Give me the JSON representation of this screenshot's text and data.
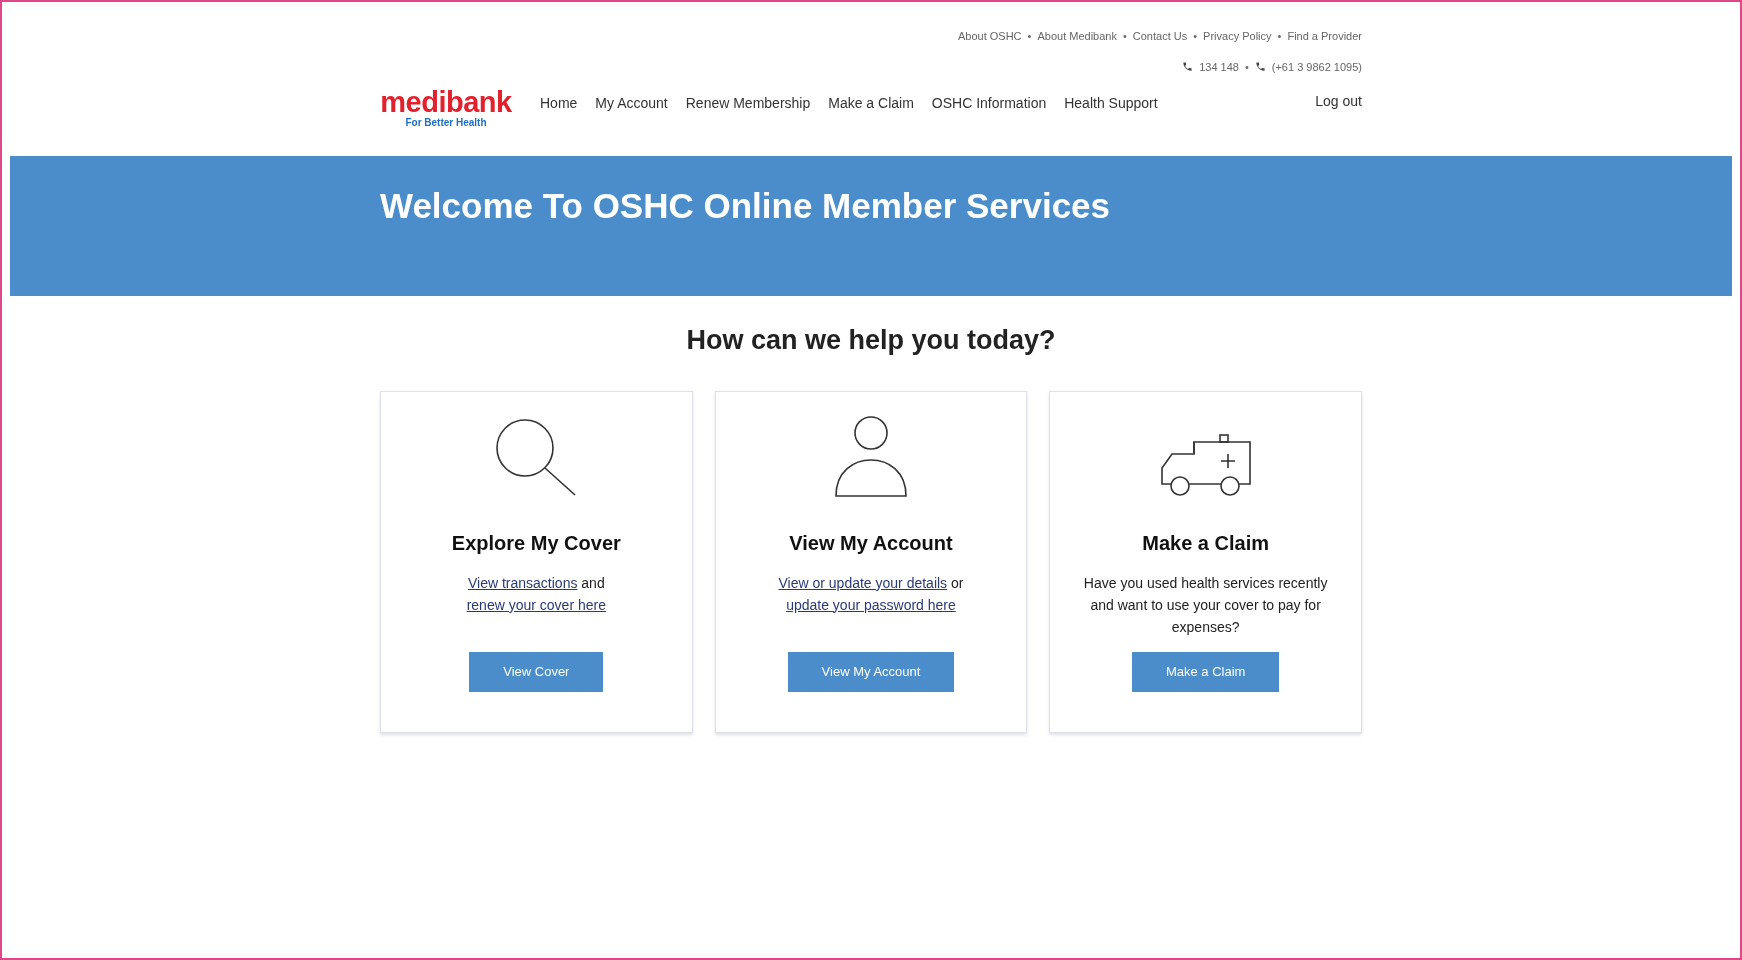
{
  "utility_links": [
    {
      "label": "About OSHC"
    },
    {
      "label": "About Medibank"
    },
    {
      "label": "Contact Us"
    },
    {
      "label": "Privacy Policy"
    },
    {
      "label": "Find a Provider"
    }
  ],
  "separator": "•",
  "phones": [
    {
      "number": "134 148"
    },
    {
      "number": "(+61 3 9862 1095)"
    }
  ],
  "logo": {
    "name": "medibank",
    "tagline": "For Better Health"
  },
  "nav": [
    {
      "label": "Home"
    },
    {
      "label": "My Account"
    },
    {
      "label": "Renew Membership"
    },
    {
      "label": "Make a Claim"
    },
    {
      "label": "OSHC Information"
    },
    {
      "label": "Health Support"
    }
  ],
  "logout": "Log out",
  "banner": {
    "title": "Welcome To OSHC Online Member Services"
  },
  "heading": "How can we help you today?",
  "cards": [
    {
      "kind": "search",
      "title": "Explore My Cover",
      "description": [
        {
          "kind": "link",
          "text": "View transactions"
        },
        {
          "kind": "text",
          "text": " and "
        },
        {
          "kind": "link",
          "text": "renew your cover here"
        }
      ],
      "button": "View Cover"
    },
    {
      "kind": "person",
      "title": "View My Account",
      "description": [
        {
          "kind": "link",
          "text": "View or update your details"
        },
        {
          "kind": "text",
          "text": " or "
        },
        {
          "kind": "link",
          "text": "update your password here"
        }
      ],
      "button": "View My Account"
    },
    {
      "kind": "ambulance",
      "title": "Make a Claim",
      "description": [
        {
          "kind": "text",
          "text": "Have you used health services recently and want to use your cover to pay for expenses?"
        }
      ],
      "button": "Make a Claim"
    }
  ]
}
